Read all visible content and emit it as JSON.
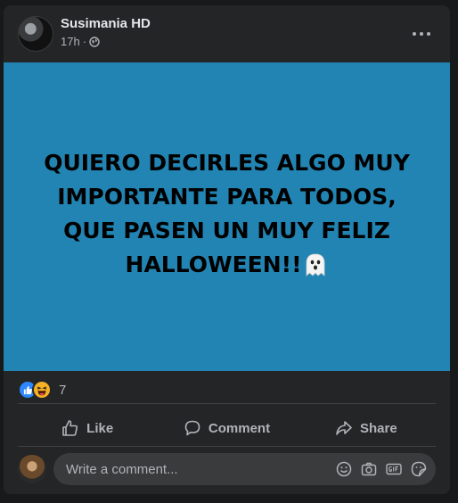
{
  "post": {
    "author": "Susimania HD",
    "time": "17h",
    "separator": "·",
    "image_text": "QUIERO DECIRLES ALGO MUY IMPORTANTE PARA TODOS, QUE PASEN UN MUY FELIZ HALLOWEEN!!",
    "image_emoji": "ghost-icon",
    "image_bg": "#2284b3"
  },
  "reactions": {
    "types": [
      "like-icon",
      "haha-icon"
    ],
    "count": "7"
  },
  "actions": {
    "like_label": "Like",
    "comment_label": "Comment",
    "share_label": "Share"
  },
  "comment": {
    "placeholder": "Write a comment...",
    "icons": [
      "smiley-icon",
      "camera-icon",
      "gif-icon",
      "sticker-icon"
    ]
  },
  "colors": {
    "page_bg": "#18191a",
    "card_bg": "#242526",
    "accent": "#2d88ff"
  }
}
